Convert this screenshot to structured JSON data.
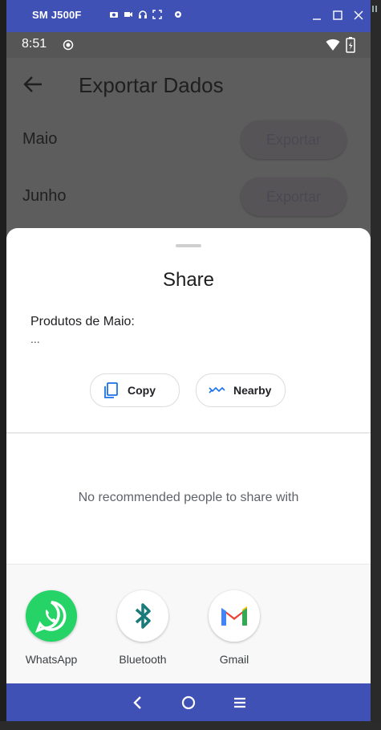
{
  "emulator": {
    "device_name": "SM J500F",
    "accent_color": "#3f51b5",
    "toolbar_icons": [
      "camera-icon",
      "video-icon",
      "headphones-icon",
      "fullscreen-icon",
      "settings-icon"
    ],
    "window_controls": [
      "minimize-icon",
      "maximize-icon",
      "close-icon"
    ]
  },
  "status_bar": {
    "time": "8:51",
    "icons": [
      "record-icon",
      "wifi-icon",
      "battery-icon"
    ]
  },
  "app_bar": {
    "title": "Exportar Dados",
    "back_icon": "back-arrow-icon"
  },
  "months": [
    {
      "label": "Maio",
      "button": "Exportar"
    },
    {
      "label": "Junho",
      "button": "Exportar"
    }
  ],
  "share_sheet": {
    "title": "Share",
    "preview_text": "Produtos de Maio:",
    "preview_more": "...",
    "actions": [
      {
        "label": "Copy",
        "icon": "copy-icon"
      },
      {
        "label": "Nearby",
        "icon": "nearby-icon"
      }
    ],
    "no_people_text": "No recommended people to share with",
    "apps": [
      {
        "label": "WhatsApp",
        "icon": "whatsapp-icon",
        "color": "#25d366"
      },
      {
        "label": "Bluetooth",
        "icon": "bluetooth-icon",
        "color": "#1b7a7a"
      },
      {
        "label": "Gmail",
        "icon": "gmail-icon",
        "color": "#ea4335"
      }
    ]
  },
  "nav_bar": {
    "buttons": [
      "nav-back-icon",
      "nav-home-icon",
      "nav-menu-icon"
    ]
  }
}
